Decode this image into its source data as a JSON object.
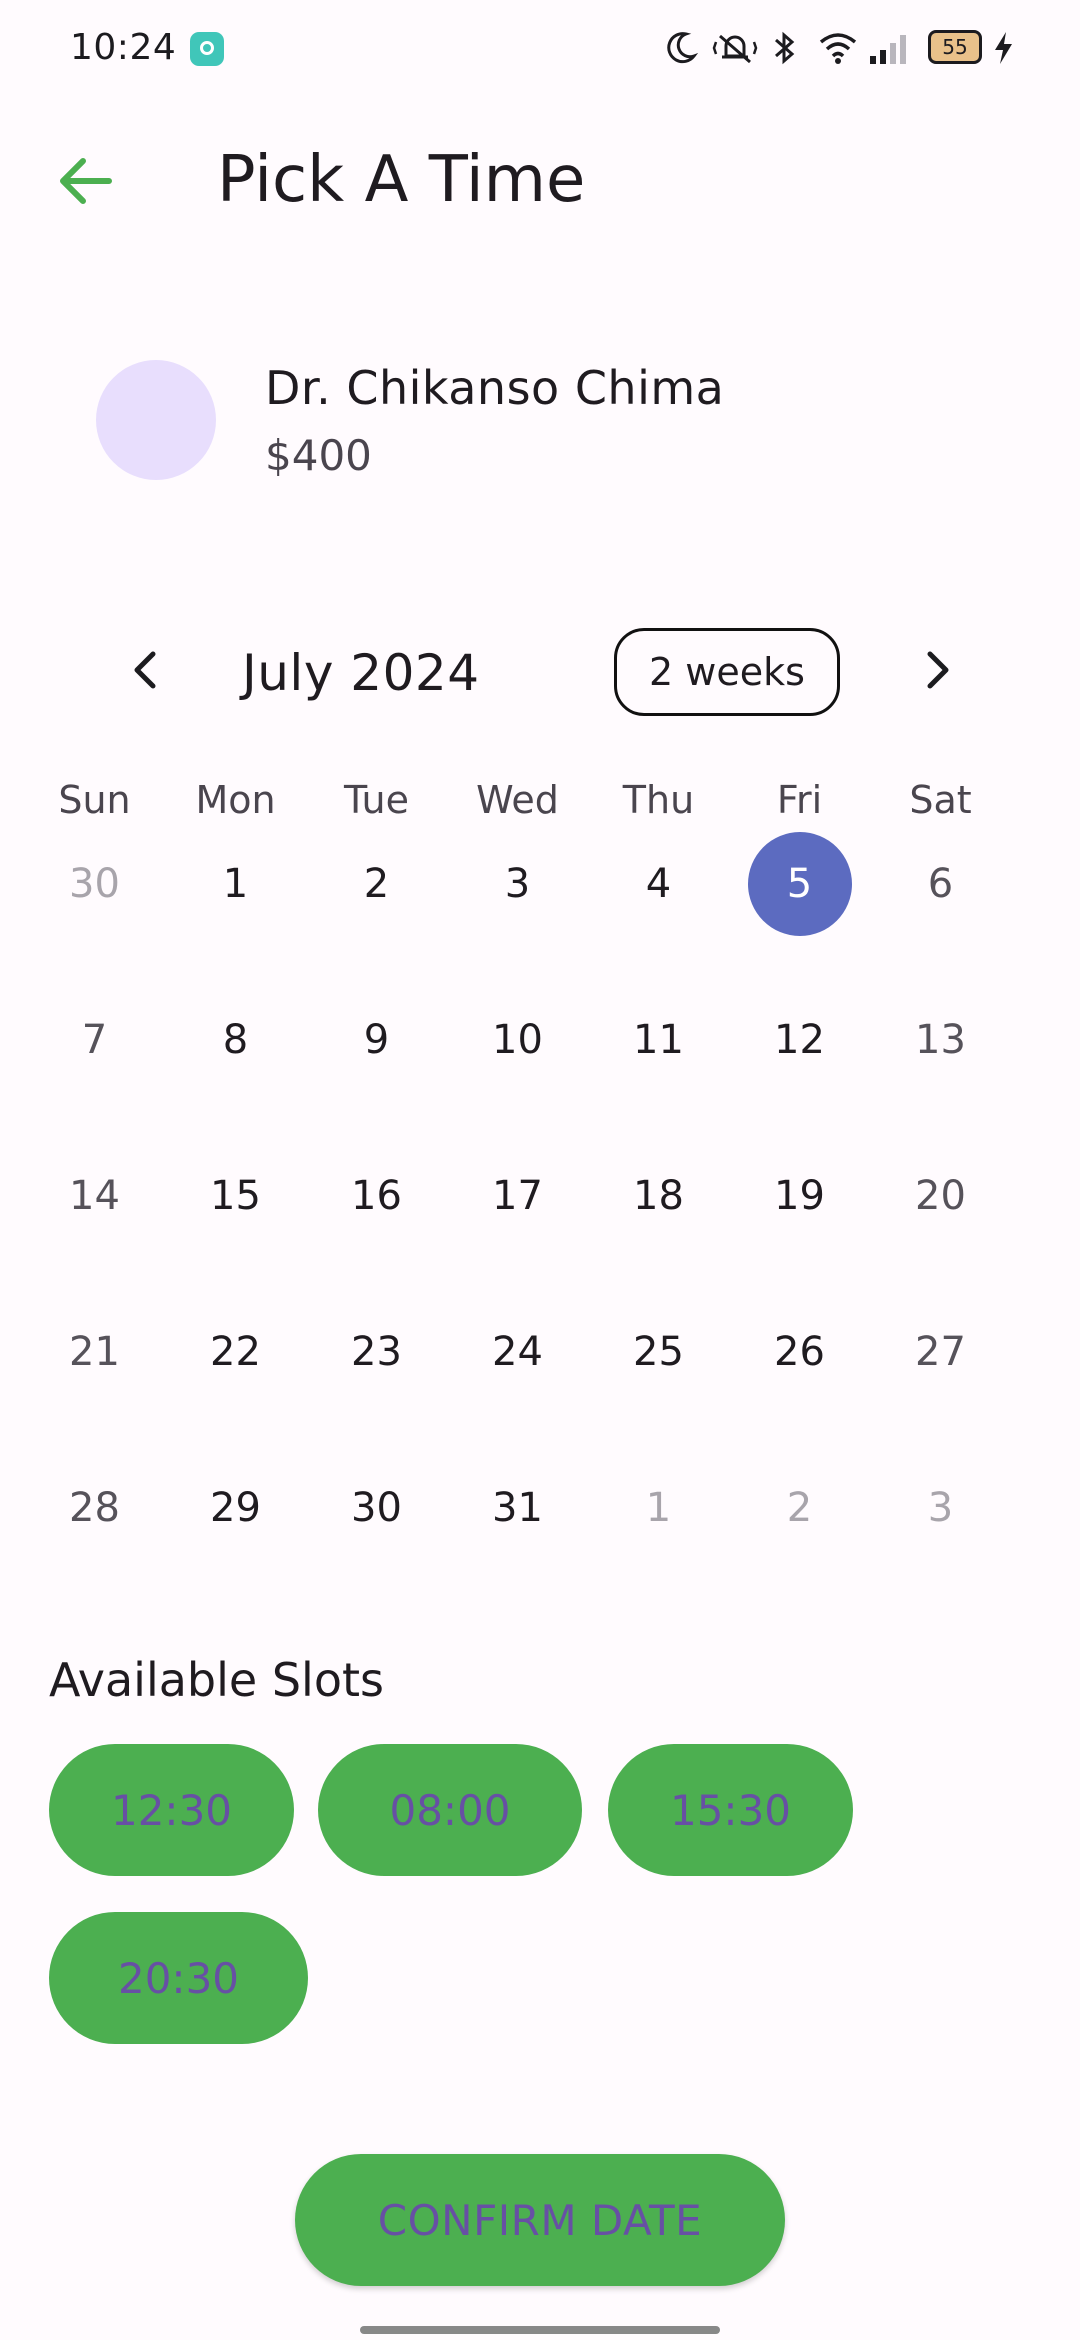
{
  "status_bar": {
    "time": "10:24",
    "battery_level": "55",
    "icons": [
      "app-notification-icon",
      "moon-icon",
      "mute-vibrate-icon",
      "bluetooth-icon",
      "wifi-icon",
      "signal-icon",
      "battery-icon",
      "charging-icon"
    ]
  },
  "header": {
    "back_icon": "arrow-left-icon",
    "title": "Pick A Time",
    "accent_color": "#4caf50"
  },
  "doctor": {
    "name": "Dr. Chikanso Chima",
    "price": "$400",
    "avatar_color": "#e8defd"
  },
  "calendar": {
    "month_title": "July 2024",
    "format_button": "2 weeks",
    "prev_icon": "chevron-left-icon",
    "next_icon": "chevron-right-icon",
    "weekdays": [
      "Sun",
      "Mon",
      "Tue",
      "Wed",
      "Thu",
      "Fri",
      "Sat"
    ],
    "days": [
      {
        "label": "30",
        "outside": true
      },
      {
        "label": "1"
      },
      {
        "label": "2"
      },
      {
        "label": "3"
      },
      {
        "label": "4"
      },
      {
        "label": "5",
        "selected": true
      },
      {
        "label": "6"
      },
      {
        "label": "7"
      },
      {
        "label": "8"
      },
      {
        "label": "9"
      },
      {
        "label": "10"
      },
      {
        "label": "11"
      },
      {
        "label": "12"
      },
      {
        "label": "13"
      },
      {
        "label": "14"
      },
      {
        "label": "15"
      },
      {
        "label": "16"
      },
      {
        "label": "17"
      },
      {
        "label": "18"
      },
      {
        "label": "19"
      },
      {
        "label": "20"
      },
      {
        "label": "21"
      },
      {
        "label": "22"
      },
      {
        "label": "23"
      },
      {
        "label": "24"
      },
      {
        "label": "25"
      },
      {
        "label": "26"
      },
      {
        "label": "27"
      },
      {
        "label": "28"
      },
      {
        "label": "29"
      },
      {
        "label": "30"
      },
      {
        "label": "31"
      },
      {
        "label": "1",
        "outside": true
      },
      {
        "label": "2",
        "outside": true
      },
      {
        "label": "3",
        "outside": true
      }
    ],
    "selected_color": "#5c6bc0"
  },
  "slots": {
    "title": "Available Slots",
    "times": [
      "12:30",
      "08:00",
      "15:30",
      "20:30"
    ],
    "button_color": "#4caf50",
    "text_color": "#6750a4"
  },
  "confirm": {
    "label": "CONFIRM DATE"
  }
}
